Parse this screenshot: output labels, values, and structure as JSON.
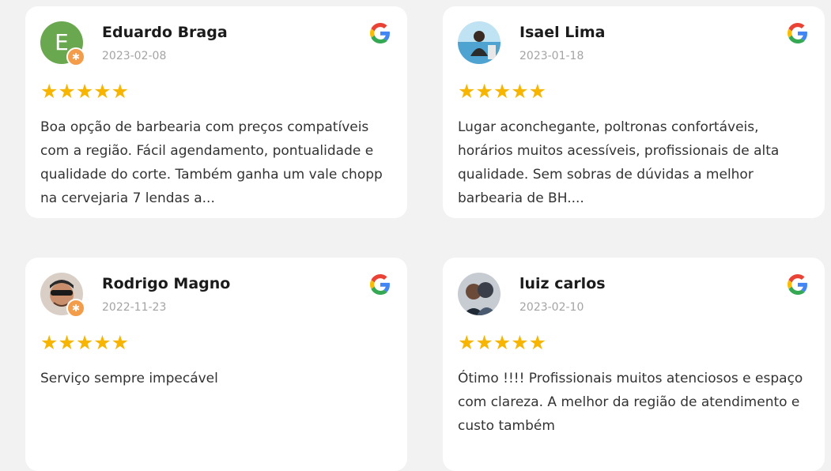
{
  "brand_colors": {
    "star": "#f7b500",
    "google_blue": "#4285F4",
    "google_red": "#EA4335",
    "google_yellow": "#FBBC05",
    "google_green": "#34A853"
  },
  "reviews": [
    {
      "name": "Eduardo Braga",
      "date": "2023-02-08",
      "avatar_letter": "E",
      "stars": "★★★★★",
      "text": "Boa opção de barbearia com preços compatíveis com a região. Fácil agendamento, pontualidade e qualidade do corte. Também ganha um vale chopp na cervejaria 7 lendas a...",
      "source_icon": "google-icon"
    },
    {
      "name": "Isael Lima",
      "date": "2023-01-18",
      "stars": "★★★★★",
      "text": "Lugar aconchegante, poltronas confortáveis, horários muitos acessíveis, profissionais de alta qualidade. Sem sobras de dúvidas a melhor barbearia de BH....",
      "source_icon": "google-icon"
    },
    {
      "name": "Rodrigo Magno",
      "date": "2022-11-23",
      "stars": "★★★★★",
      "text": "Serviço sempre impecável",
      "source_icon": "google-icon"
    },
    {
      "name": "luiz carlos",
      "date": "2023-02-10",
      "stars": "★★★★★",
      "text": "Ótimo !!!! Profissionais muitos atenciosos e espaço com clareza. A melhor da região de atendimento e custo também",
      "source_icon": "google-icon"
    }
  ]
}
